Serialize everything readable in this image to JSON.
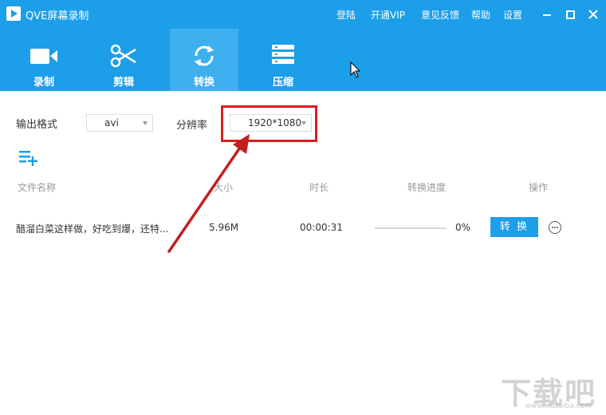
{
  "app": {
    "title": "QVE屏幕录制"
  },
  "top_links": {
    "login": "登陆",
    "vip": "开通VIP",
    "feedback": "意见反馈",
    "help": "帮助",
    "settings": "设置"
  },
  "tabs": [
    {
      "label": "录制",
      "icon": "video-camera-icon",
      "active": false
    },
    {
      "label": "剪辑",
      "icon": "scissors-icon",
      "active": false
    },
    {
      "label": "转换",
      "icon": "convert-refresh-icon",
      "active": true
    },
    {
      "label": "压缩",
      "icon": "compress-icon",
      "active": false
    }
  ],
  "settings": {
    "format_label": "输出格式",
    "format_value": "avi",
    "resolution_label": "分辨率",
    "resolution_value": "1920*1080"
  },
  "table": {
    "headers": {
      "name": "文件名称",
      "size": "大小",
      "duration": "时长",
      "progress": "转换进度",
      "action": "操作"
    },
    "rows": [
      {
        "name": "醋溜白菜这样做，好吃到爆，还特...",
        "size": "5.96M",
        "duration": "00:00:31",
        "progress_percent": 0,
        "progress_text": "0%",
        "action_label": "转 换"
      }
    ]
  },
  "watermark": {
    "text": "下载吧",
    "sub": "www.xiazaiba.com"
  },
  "colors": {
    "brand": "#1c9ee8",
    "tab_active": "#3eb0f0",
    "annotation": "#d92020"
  }
}
